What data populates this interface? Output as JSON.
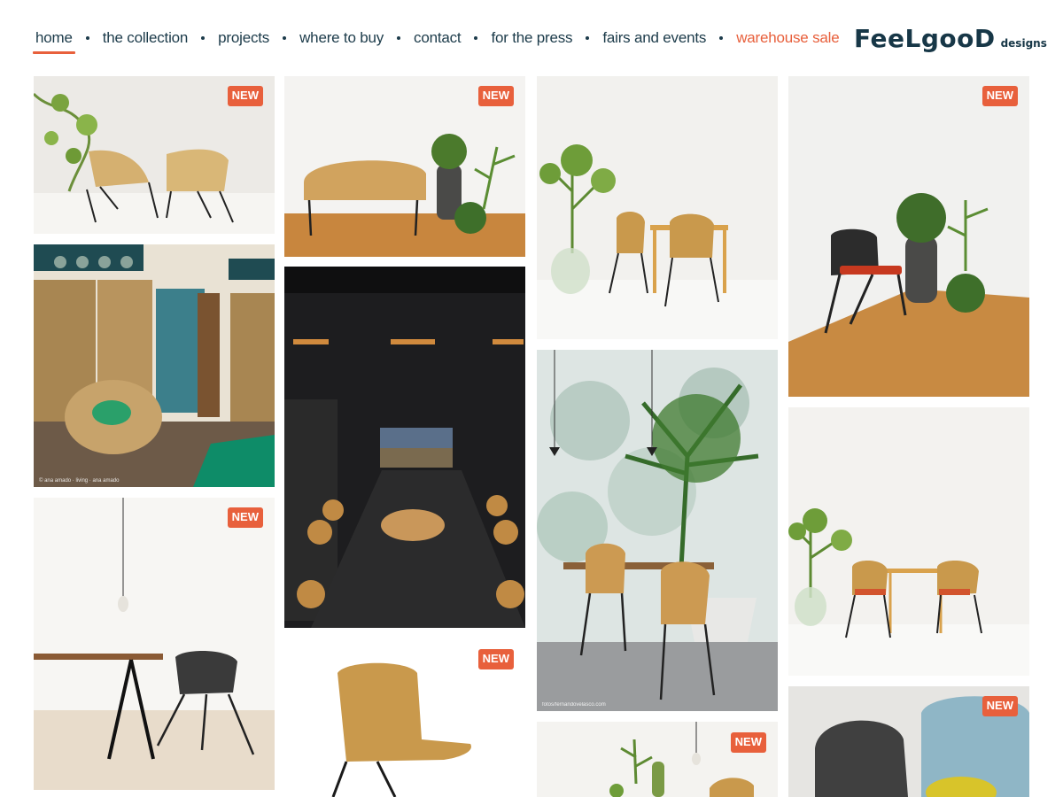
{
  "header": {
    "nav": [
      {
        "label": "home",
        "active": true
      },
      {
        "label": "the collection"
      },
      {
        "label": "projects"
      },
      {
        "label": "where to buy"
      },
      {
        "label": "contact"
      },
      {
        "label": "for the press"
      },
      {
        "label": "fairs and events"
      },
      {
        "label": "warehouse sale",
        "accent": true
      }
    ],
    "logo": {
      "wordmark": "FeeLgooD",
      "subtitle": "designs"
    }
  },
  "tiles": {
    "badge_label": "NEW",
    "credits": {
      "interior": "© ana amado · living · ana amado",
      "restaurant": "fotos/fernandovelasco.com"
    }
  },
  "colors": {
    "accent": "#e8603c",
    "brand": "#173747",
    "text": "#1c3b4a"
  }
}
